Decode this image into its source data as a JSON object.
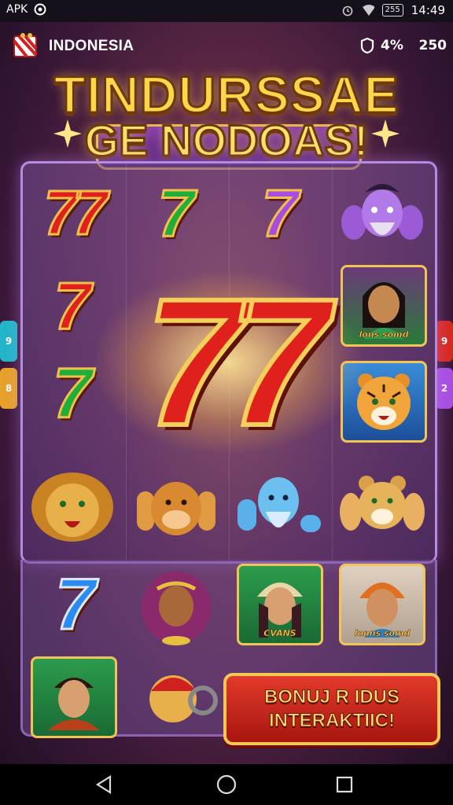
{
  "status_bar": {
    "left_label": "APK",
    "battery_label": "255",
    "time": "14:49"
  },
  "header": {
    "country": "INDONESIA",
    "percent": "4%",
    "coins": "250"
  },
  "title": {
    "line1": "TINDURSSAE",
    "line2": "GE NODOAS!"
  },
  "reels": {
    "row1": [
      "77",
      "7",
      "7"
    ],
    "row2": [
      "7"
    ],
    "row3": [
      "7"
    ],
    "lower": [
      "7"
    ],
    "big_symbol": "77",
    "card_captions": {
      "warrior_card": "lons somd",
      "woman_card": "CVANS",
      "turban_card": "lonns somd"
    }
  },
  "side_tabs": {
    "left_top": "9",
    "left_bottom": "8",
    "right_top": "9",
    "right_bottom": "2"
  },
  "bonus_button": {
    "line1": "BONUJ R IDUS",
    "line2": "INTERAKTIIC!"
  },
  "colors": {
    "gold": "#f5c754",
    "red_button": "#d8281c",
    "frame_purple": "#b58be0"
  }
}
